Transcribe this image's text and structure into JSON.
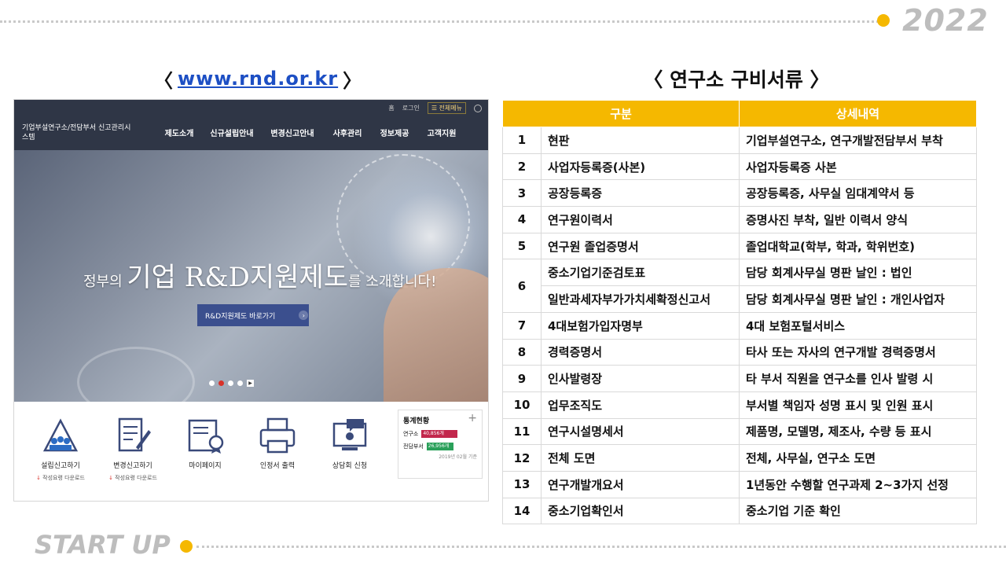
{
  "header": {
    "year": "2022"
  },
  "footer": {
    "label": "START UP"
  },
  "left_section": {
    "open": "〈",
    "url": "www.rnd.or.kr",
    "close": "〉"
  },
  "right_section": {
    "title": "〈 연구소 구비서류 〉"
  },
  "site": {
    "util": {
      "home": "홈",
      "login": "로그인",
      "all_menu": "☰ 전체메뉴"
    },
    "logo": "기업부설연구소/전담부서 신고관리시스템",
    "nav": [
      "제도소개",
      "신규설립안내",
      "변경신고안내",
      "사후관리",
      "정보제공",
      "고객지원"
    ],
    "hero": {
      "text_pre": "정부의 ",
      "text_big": "기업 R&D지원제도",
      "text_post": "를 소개합니다!",
      "button": "R&D지원제도 바로가기",
      "button_arrow": "›"
    },
    "quick": [
      {
        "label": "설립신고하기",
        "sub": "작성요령 다운로드",
        "icon": "building-people-icon"
      },
      {
        "label": "변경신고하기",
        "sub": "작성요령 다운로드",
        "icon": "document-pen-icon"
      },
      {
        "label": "마이페이지",
        "sub": "",
        "icon": "certificate-icon"
      },
      {
        "label": "인정서 출력",
        "sub": "",
        "icon": "printer-icon"
      },
      {
        "label": "상담회 신청",
        "sub": "",
        "icon": "monitor-chat-icon"
      }
    ],
    "stats": {
      "title": "통계현황",
      "plus": "+",
      "rows": [
        {
          "name": "연구소",
          "value": "40,856개",
          "color": "#c2274c"
        },
        {
          "name": "전담부서",
          "value": "26,956개",
          "color": "#2aa05a"
        }
      ],
      "date": "2019년 02월 기준"
    }
  },
  "table": {
    "headers": [
      "구분",
      "상세내역"
    ],
    "rows": [
      {
        "no": "1",
        "name": "현판",
        "detail": "기업부설연구소, 연구개발전담부서 부착"
      },
      {
        "no": "2",
        "name": "사업자등록증(사본)",
        "detail": "사업자등록증 사본"
      },
      {
        "no": "3",
        "name": "공장등록증",
        "detail": "공장등록증, 사무실 임대계약서 등"
      },
      {
        "no": "4",
        "name": "연구원이력서",
        "detail": "증명사진 부착, 일반 이력서 양식"
      },
      {
        "no": "5",
        "name": "연구원 졸업증명서",
        "detail": "졸업대학교(학부, 학과, 학위번호)"
      },
      {
        "no": "6",
        "name": "중소기업기준검토표",
        "detail": "담당 회계사무실 명판 날인 : 법인"
      },
      {
        "no": "",
        "name": "일반과세자부가가치세확정신고서",
        "detail": "담당 회계사무실 명판 날인 : 개인사업자"
      },
      {
        "no": "7",
        "name": "4대보험가입자명부",
        "detail": "4대 보험포털서비스"
      },
      {
        "no": "8",
        "name": "경력증명서",
        "detail": "타사 또는 자사의 연구개발 경력증명서"
      },
      {
        "no": "9",
        "name": "인사발령장",
        "detail": "타 부서 직원을 연구소를 인사 발령 시"
      },
      {
        "no": "10",
        "name": "업무조직도",
        "detail": "부서별 책임자 성명 표시 및 인원 표시"
      },
      {
        "no": "11",
        "name": "연구시설명세서",
        "detail": "제품명, 모델명, 제조사, 수량 등 표시"
      },
      {
        "no": "12",
        "name": "전체 도면",
        "detail": "전체, 사무실, 연구소 도면"
      },
      {
        "no": "13",
        "name": "연구개발개요서",
        "detail": "1년동안 수행할 연구과제 2~3가지 선정"
      },
      {
        "no": "14",
        "name": "중소기업확인서",
        "detail": "중소기업 기준 확인"
      }
    ]
  }
}
